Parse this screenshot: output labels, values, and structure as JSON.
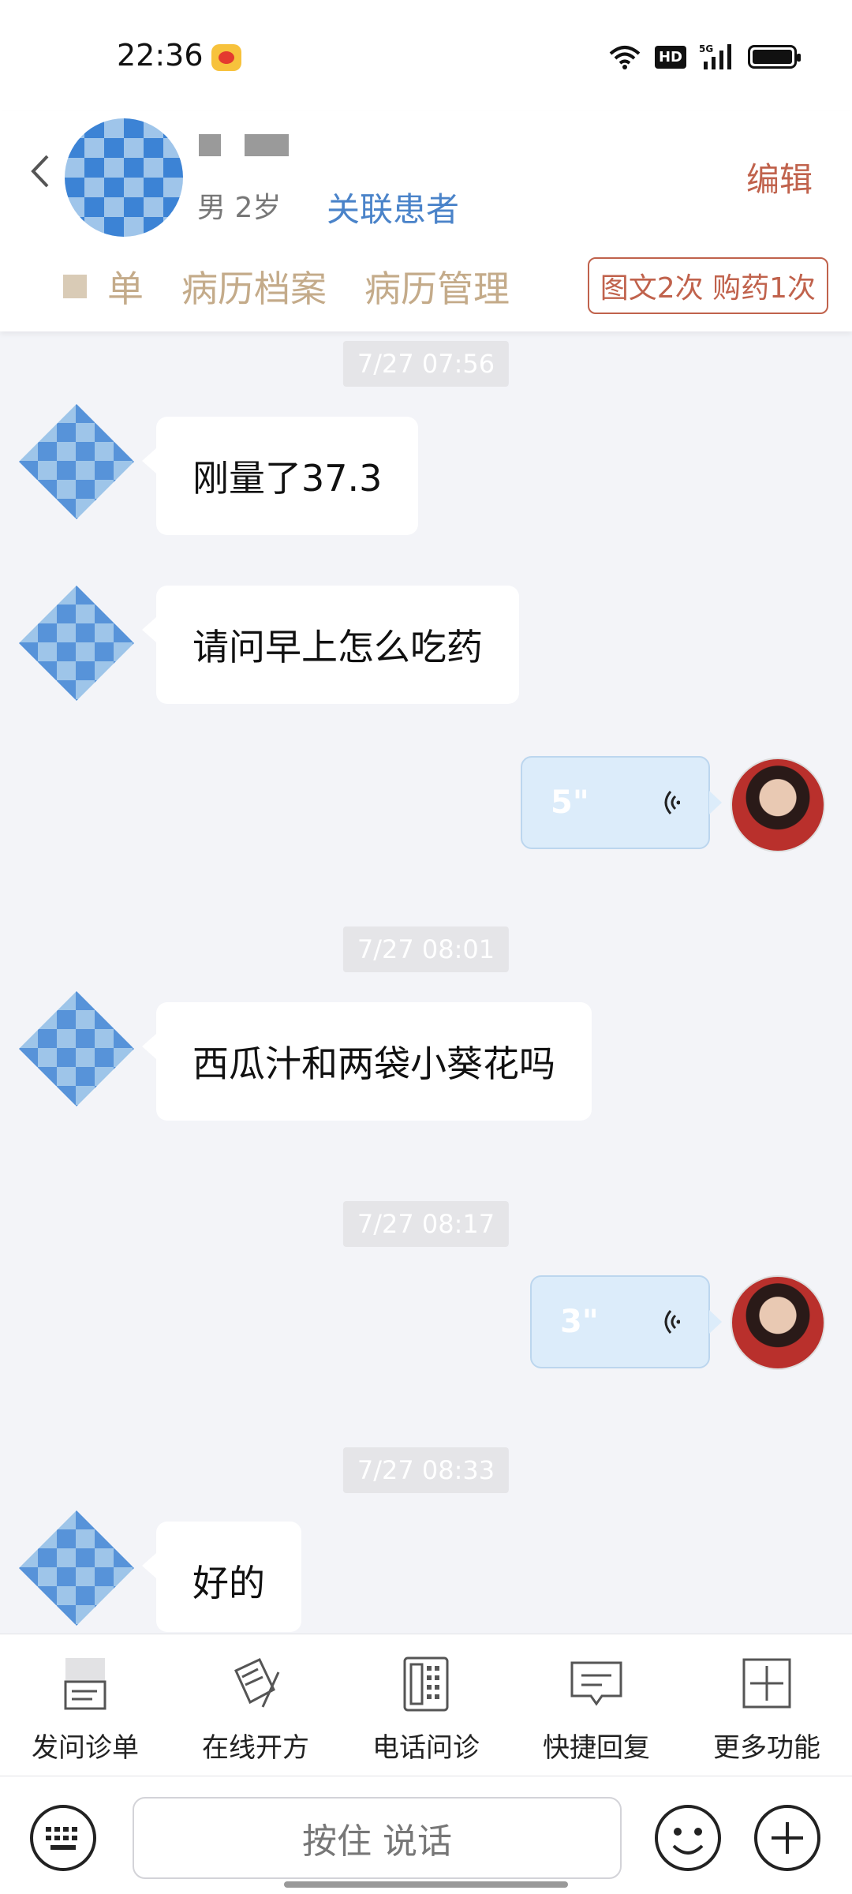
{
  "status_bar": {
    "time": "22:36",
    "network": "5G",
    "hd": "HD"
  },
  "header": {
    "patient_meta": "男 2岁",
    "link_patient": "关联患者",
    "edit": "编辑",
    "tabs": [
      "单",
      "病历档案",
      "病历管理"
    ],
    "badge": "图文2次 购药1次"
  },
  "chat": {
    "timestamps": [
      "7/27 07:56",
      "7/27 08:01",
      "7/27 08:17",
      "7/27 08:33"
    ],
    "messages": [
      {
        "side": "left",
        "text": "刚量了37.3"
      },
      {
        "side": "left",
        "text": "请问早上怎么吃药"
      },
      {
        "side": "right",
        "type": "voice",
        "duration": "5\""
      },
      {
        "side": "left",
        "text": "西瓜汁和两袋小葵花吗"
      },
      {
        "side": "right",
        "type": "voice",
        "duration": "3\""
      },
      {
        "side": "left",
        "text": "好的"
      }
    ]
  },
  "toolbar": {
    "items": [
      {
        "label": "发问诊单",
        "icon": "form-icon"
      },
      {
        "label": "在线开方",
        "icon": "prescription-icon"
      },
      {
        "label": "电话问诊",
        "icon": "phone-icon"
      },
      {
        "label": "快捷回复",
        "icon": "message-icon"
      },
      {
        "label": "更多功能",
        "icon": "plus-square-icon"
      }
    ]
  },
  "input_bar": {
    "hold_to_talk": "按住 说话"
  },
  "colors": {
    "accent_brown": "#c0624c",
    "link_blue": "#4a83c9",
    "tab_gold": "#c4ab8a",
    "voice_bubble": "#dcecfa"
  }
}
